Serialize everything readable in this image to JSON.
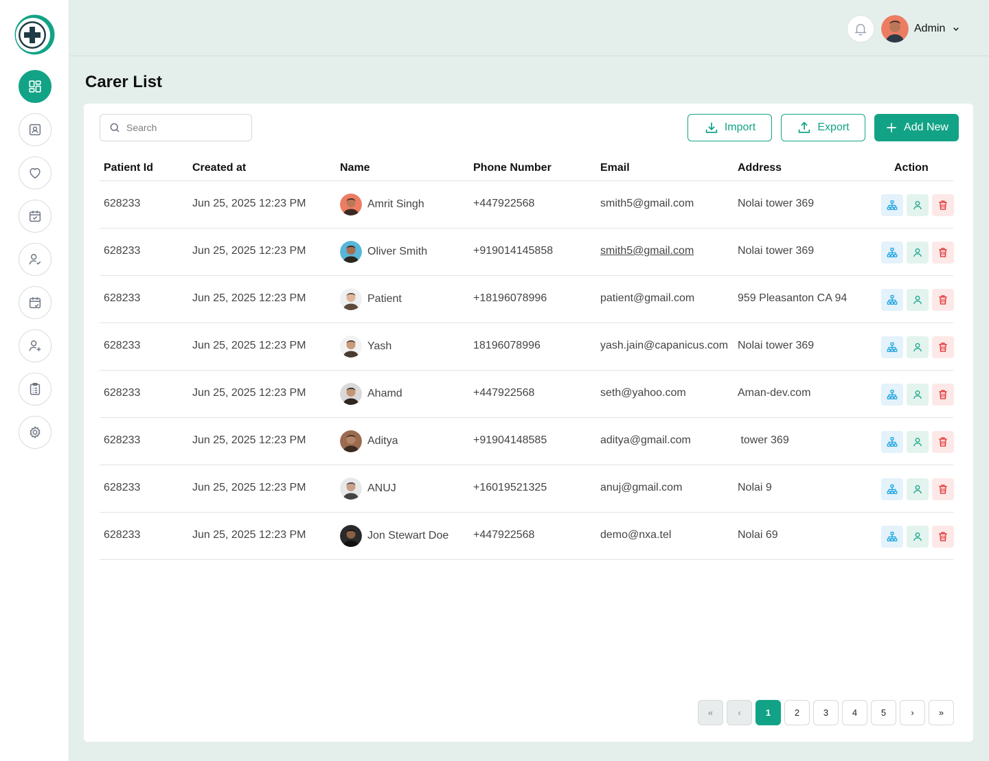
{
  "header": {
    "user_name": "Admin"
  },
  "page": {
    "title": "Carer List"
  },
  "toolbar": {
    "search_placeholder": "Search",
    "import_label": "Import",
    "export_label": "Export",
    "add_label": "Add New"
  },
  "table": {
    "columns": [
      "Patient Id",
      "Created at",
      "Name",
      "Phone Number",
      "Email",
      "Address",
      "Action"
    ],
    "rows": [
      {
        "id": "628233",
        "created": "Jun 25, 2025 12:23 PM",
        "name": "Amrit Singh",
        "phone": "+447922568",
        "email": "smith5@gmail.com",
        "address": "Nolai tower 369"
      },
      {
        "id": "628233",
        "created": "Jun 25, 2025 12:23 PM",
        "name": "Oliver Smith",
        "phone": "+919014145858",
        "email": "smith5@gmail.com",
        "address": "Nolai tower 369"
      },
      {
        "id": "628233",
        "created": "Jun 25, 2025 12:23 PM",
        "name": "Patient",
        "phone": "+18196078996",
        "email": "patient@gmail.com",
        "address": "959 Pleasanton CA 94"
      },
      {
        "id": "628233",
        "created": "Jun 25, 2025 12:23 PM",
        "name": "Yash",
        "phone": "18196078996",
        "email": "yash.jain@capanicus.com",
        "address": "Nolai tower 369"
      },
      {
        "id": "628233",
        "created": "Jun 25, 2025 12:23 PM",
        "name": "Ahamd",
        "phone": "+447922568",
        "email": "seth@yahoo.com",
        "address": "Aman-dev.com"
      },
      {
        "id": "628233",
        "created": "Jun 25, 2025 12:23 PM",
        "name": "Aditya",
        "phone": "+91904148585",
        "email": "aditya@gmail.com",
        "address": " tower 369"
      },
      {
        "id": "628233",
        "created": "Jun 25, 2025 12:23 PM",
        "name": "ANUJ",
        "phone": "+16019521325",
        "email": "anuj@gmail.com",
        "address": "Nolai 9"
      },
      {
        "id": "628233",
        "created": "Jun 25, 2025 12:23 PM",
        "name": "Jon Stewart Doe",
        "phone": "+447922568",
        "email": "demo@nxa.tel",
        "address": "Nolai 69"
      }
    ]
  },
  "pagination": {
    "first": "«",
    "prev": "‹",
    "pages": [
      "1",
      "2",
      "3",
      "4",
      "5"
    ],
    "current": "1",
    "next": "›",
    "last": "»"
  },
  "colors": {
    "accent": "#12a386",
    "background": "#e4efec",
    "action_blue": "#1aa3e0",
    "action_green": "#12a386",
    "action_red": "#e02424"
  },
  "icons": {
    "sidebar": [
      "dashboard-icon",
      "profile-card-icon",
      "heart-icon",
      "calendar-check-icon",
      "user-check-icon",
      "calendar-check-icon",
      "user-plus-icon",
      "clipboard-list-icon",
      "gear-icon"
    ],
    "row_actions": [
      "hierarchy-icon",
      "user-icon",
      "trash-icon"
    ]
  }
}
